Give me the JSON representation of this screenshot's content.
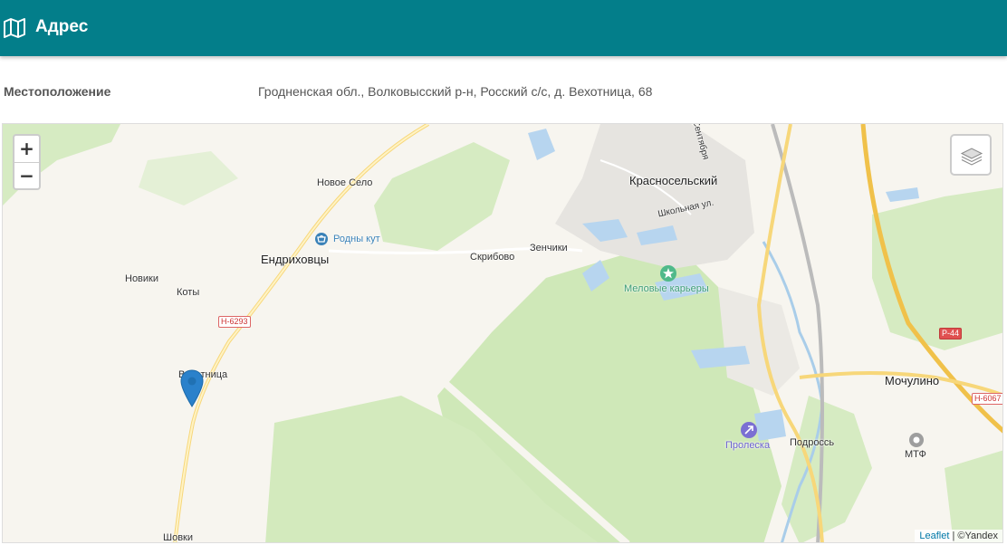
{
  "header": {
    "title": "Адрес",
    "icon": "map-icon",
    "bg_color": "#037e8a"
  },
  "location": {
    "label": "Местоположение",
    "value": "Гродненская обл., Волковысский р-н, Росский с/с, д. Вехотница, 68"
  },
  "map": {
    "zoom_in": "+",
    "zoom_out": "−",
    "layers_icon": "layers-icon",
    "places": {
      "novoe_selo": "Новое Село",
      "rodny_kut": "Родны кут",
      "endrihovcy": "Ендриховцы",
      "noviki": "Новики",
      "koty": "Коты",
      "vehotnica": "Вехотница",
      "skribovo": "Скрибово",
      "zenchiki": "Зенчики",
      "krasnoselsky": "Красносельский",
      "shkolnaya": "Школьная ул.",
      "sentyabrya": "Сентября",
      "melovye": "Меловые карьеры",
      "mochulino": "Мочулино",
      "proleska": "Пролеска",
      "podross": "Подроссь",
      "mtf": "МТФ",
      "shovki": "Шовки"
    },
    "roads": {
      "h6293": "Н-6293",
      "p44": "Р-44",
      "h6067": "Н-6067"
    },
    "attribution": {
      "leaflet": "Leaflet",
      "separator": " | ",
      "provider": "©Yandex"
    }
  }
}
